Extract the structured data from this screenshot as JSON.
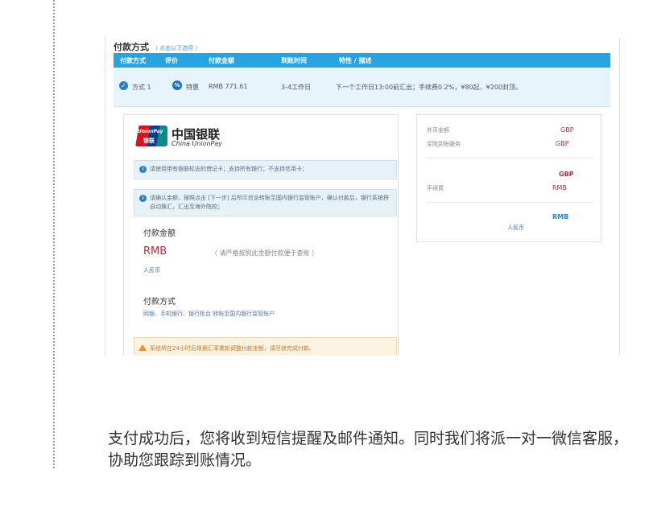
{
  "section": {
    "title": "付款方式",
    "hint": "（ 点击以下选项 ）"
  },
  "table": {
    "headers": [
      "付款方式",
      "评价",
      "付款金额",
      "到账时间",
      "特性 / 描述"
    ],
    "row": {
      "method": "方式 1",
      "rating": "特惠",
      "amount": "RMB 771.61",
      "time": "3-4工作日",
      "desc": "下一个工作日13:00前汇出；手续费0.2%，¥80起，¥200封顶。"
    }
  },
  "unionpay": {
    "badge_en": "UnionPay",
    "badge_cn": "银联",
    "name_cn": "中国银联",
    "name_en": "China UnionPay",
    "notice1": "请使用带有银联标志的借记卡；支持所有银行；不支持信用卡；",
    "notice2": "请确认金额，按照点击 [下一步] 后所示信息转账至国内银行监管账户，确认付款后，银行系统将自动换汇，汇出至海外院校；",
    "amount_label": "付款金额",
    "amount_value": "RMB",
    "amount_hint": "（ 请严格按照此金额付款便于查账 ）",
    "amount_unit": "人民币",
    "method_label": "付款方式",
    "method_desc": "网银、手机银行、银行柜台 转账至国内银行监管账户",
    "warning": "系统将在24小时后根据汇率重新调整付款金额，请尽快完成付款。"
  },
  "summary": {
    "foreign_label": "外币金额",
    "foreign_value": "GBP",
    "service_label": "至院到账服务",
    "service_value": "GBP",
    "mid_value": "GBP",
    "fee_label": "手续费",
    "fee_value": "RMB",
    "total_value": "RMB",
    "total_unit": "人民币"
  },
  "caption": "支付成功后，您将收到短信提醒及邮件通知。同时我们将派一对一微信客服，协助您跟踪到账情况。"
}
